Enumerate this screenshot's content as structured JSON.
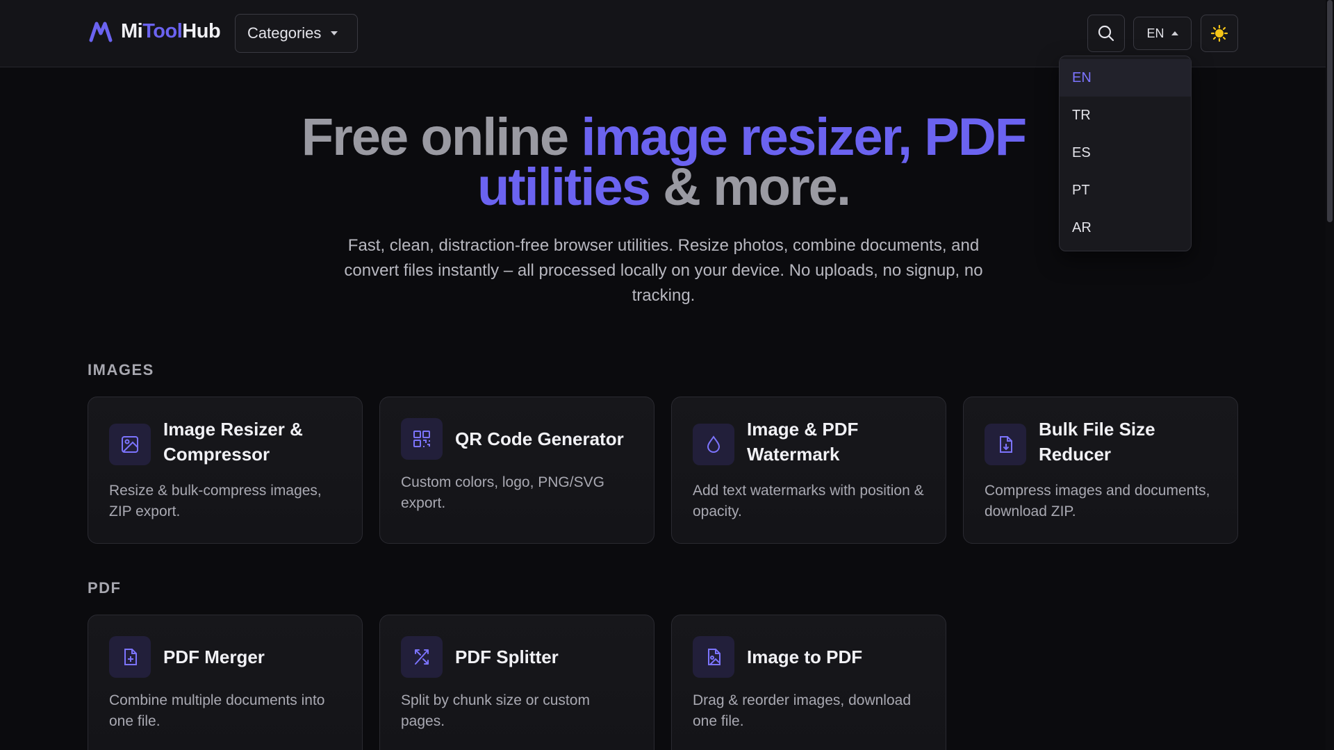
{
  "header": {
    "logo_part1": "Mi",
    "logo_part2": "Tool",
    "logo_part3": "Hub",
    "categories_label": "Categories",
    "language_current": "EN",
    "search_icon": "search-icon",
    "theme_icon": "sun-icon"
  },
  "language_menu": {
    "items": [
      {
        "label": "EN",
        "active": true
      },
      {
        "label": "TR"
      },
      {
        "label": "ES"
      },
      {
        "label": "PT"
      },
      {
        "label": "AR"
      }
    ]
  },
  "hero": {
    "title_part1": "Free online ",
    "title_highlight": "image resizer, PDF utilities",
    "title_part2": " & more.",
    "subtitle": "Fast, clean, distraction-free browser utilities. Resize photos, combine documents, and convert files instantly – all processed locally on your device. No uploads, no signup, no tracking."
  },
  "sections": [
    {
      "label": "IMAGES",
      "cards": [
        {
          "title": "Image Resizer & Compressor",
          "description": "Resize & bulk-compress images, ZIP export.",
          "icon": "image-icon"
        },
        {
          "title": "QR Code Generator",
          "description": "Custom colors, logo, PNG/SVG export.",
          "icon": "qr-code-icon"
        },
        {
          "title": "Image & PDF Watermark",
          "description": "Add text watermarks with position & opacity.",
          "icon": "droplet-icon"
        },
        {
          "title": "Bulk File Size Reducer",
          "description": "Compress images and documents, download ZIP.",
          "icon": "file-download-icon"
        }
      ]
    },
    {
      "label": "PDF",
      "cards": [
        {
          "title": "PDF Merger",
          "description": "Combine multiple documents into one file.",
          "icon": "file-plus-icon"
        },
        {
          "title": "PDF Splitter",
          "description": "Split by chunk size or custom pages.",
          "icon": "split-icon"
        },
        {
          "title": "Image to PDF",
          "description": "Drag & reorder images, download one file.",
          "icon": "file-image-icon"
        }
      ]
    }
  ],
  "colors": {
    "accent": "#6b63f0",
    "background": "#0b0b0e",
    "header_bg": "#141418",
    "card_bg": "#17171b",
    "icon_bg": "#221f3a",
    "sun": "#f5c518"
  }
}
